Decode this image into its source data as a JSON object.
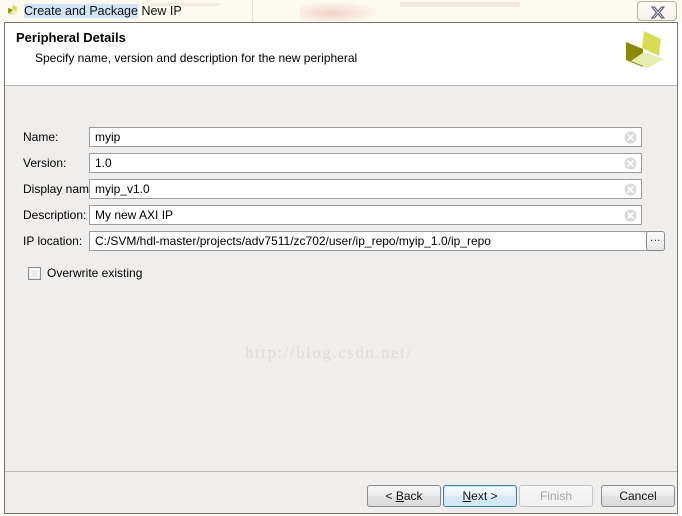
{
  "window": {
    "title_selected": "Create and Package",
    "title_rest": " New IP",
    "app_icon": "xilinx-logo-icon",
    "close_label": "✕"
  },
  "header": {
    "title": "Peripheral Details",
    "subtitle": "Specify name, version and description for the new peripheral",
    "logo": "xilinx-logo-icon"
  },
  "form": {
    "fields": [
      {
        "label": "Name:",
        "value": "myip",
        "clear_icon": "clear-circle-icon"
      },
      {
        "label": "Version:",
        "value": "1.0",
        "clear_icon": "clear-circle-icon"
      },
      {
        "label": "Display name:",
        "value": "myip_v1.0",
        "clear_icon": "clear-circle-icon"
      },
      {
        "label": "Description:",
        "value": "My new AXI IP",
        "clear_icon": "clear-circle-icon"
      },
      {
        "label": "IP location:",
        "value": "C:/SVM/hdl-master/projects/adv7511/zc702/user/ip_repo/myip_1.0/ip_repo",
        "clear_icon": "clear-circle-icon"
      }
    ],
    "browse_label": "...",
    "overwrite": {
      "label": "Overwrite existing",
      "checked": false
    }
  },
  "watermark": "http://blog.csdn.net/",
  "buttons": {
    "back": {
      "pre": "< ",
      "mnemonic": "B",
      "post": "ack"
    },
    "next": {
      "pre": "",
      "mnemonic": "N",
      "post": "ext >"
    },
    "finish": {
      "pre": "",
      "mnemonic": "F",
      "post": "inish"
    },
    "cancel": {
      "label": "Cancel"
    }
  },
  "colors": {
    "titlebar": "#fdfaf0",
    "dialog_bg": "#efeeec",
    "header_bg": "#ffffff",
    "border": "#7d7464",
    "default_button_border": "#3c7fb1",
    "logo_dark": "#8a8a00",
    "logo_mid": "#d6dd53",
    "logo_light": "#e8edb0"
  }
}
